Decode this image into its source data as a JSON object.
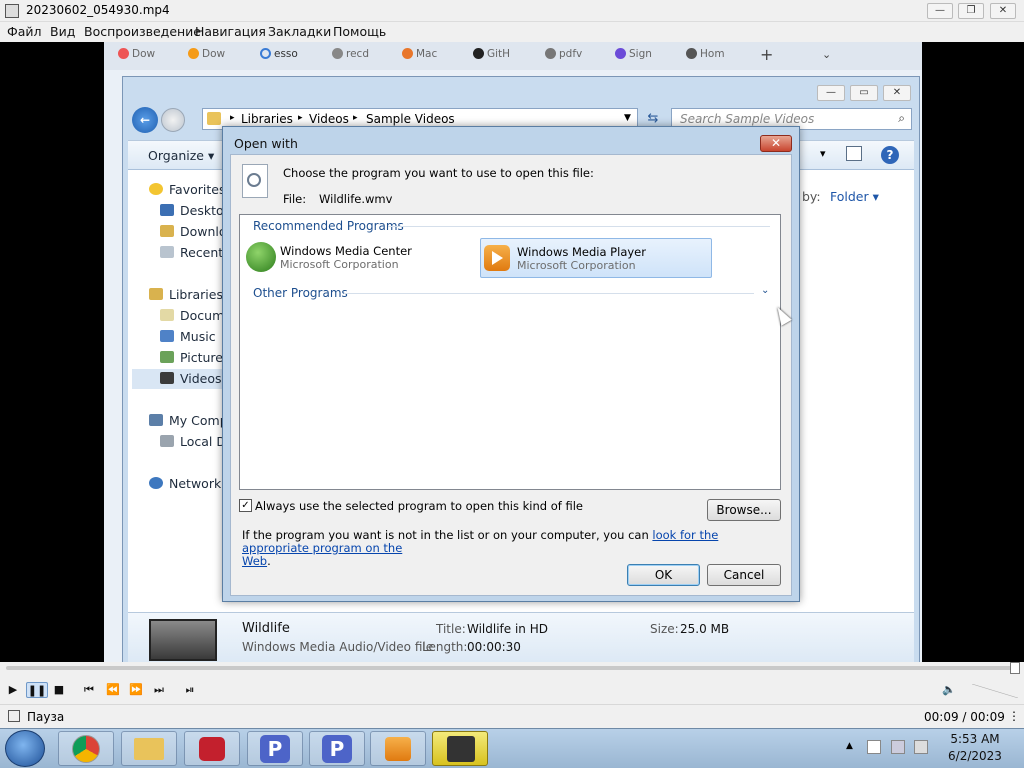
{
  "player": {
    "title": "20230602_054930.mp4",
    "menu": [
      "Файл",
      "Вид",
      "Воспроизведение",
      "Навигация",
      "Закладки",
      "Помощь"
    ],
    "status": "Пауза",
    "time": "00:09 / 00:09"
  },
  "browser": {
    "tabs": [
      "Dow",
      "Dow",
      "esso",
      "recd",
      "Mac",
      "GitH",
      "pdfv",
      "Sign",
      "Hom"
    ]
  },
  "explorer": {
    "breadcrumb": [
      "Libraries",
      "Videos",
      "Sample Videos"
    ],
    "search_placeholder": "Search Sample Videos",
    "organize": "Organize",
    "arrange_label": "by:",
    "arrange_value": "Folder",
    "nav": {
      "favorites": "Favorites",
      "desktop": "Desktop",
      "downloads": "Downlo",
      "recent": "Recent P",
      "libraries": "Libraries",
      "documents": "Docume",
      "music": "Music",
      "pictures": "Pictures",
      "videos": "Videos",
      "computer": "My Comp",
      "local_disk": "Local Di",
      "network": "Network"
    },
    "details": {
      "name": "Wildlife",
      "type": "Windows Media Audio/Video file",
      "title_label": "Title:",
      "title_value": "Wildlife in HD",
      "length_label": "Length:",
      "length_value": "00:00:30",
      "size_label": "Size:",
      "size_value": "25.0 MB"
    }
  },
  "dialog": {
    "title": "Open with",
    "prompt": "Choose the program you want to use to open this file:",
    "file_label": "File:",
    "file_name": "Wildlife.wmv",
    "recommended_header": "Recommended Programs",
    "other_header": "Other Programs",
    "programs": [
      {
        "name": "Windows Media Center",
        "company": "Microsoft Corporation"
      },
      {
        "name": "Windows Media Player",
        "company": "Microsoft Corporation"
      }
    ],
    "always_use_label": "Always use the selected program to open this kind of file",
    "browse_label": "Browse...",
    "info_prefix": "If the program you want is not in the list or on your computer, you can ",
    "info_link_1": "look for the appropriate program on the",
    "info_link_2": "Web",
    "info_suffix": ".",
    "ok_label": "OK",
    "cancel_label": "Cancel"
  },
  "taskbar": {
    "time": "5:53 AM",
    "date": "6/2/2023"
  }
}
